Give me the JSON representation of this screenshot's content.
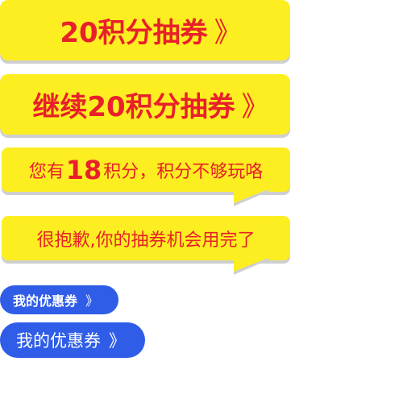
{
  "buttons": {
    "draw_label": "20积分抽券",
    "continue_label": "继续20积分抽券",
    "chevron": "》"
  },
  "bubbles": {
    "points_prefix": "您有",
    "points_value": "18",
    "points_suffix": "积分，积分不够玩咯",
    "exhausted_text": "很抱歉,你的抽券机会用完了"
  },
  "coupons": {
    "small_label": "我的优惠券",
    "large_label": "我的优惠券",
    "chevron": "》"
  },
  "colors": {
    "yellow": "#fcee21",
    "red_text": "#e8202a",
    "blue": "#2f5de8",
    "shadow": "#cfcfcf"
  },
  "icons": [
    "double-chevron-right-icon"
  ]
}
